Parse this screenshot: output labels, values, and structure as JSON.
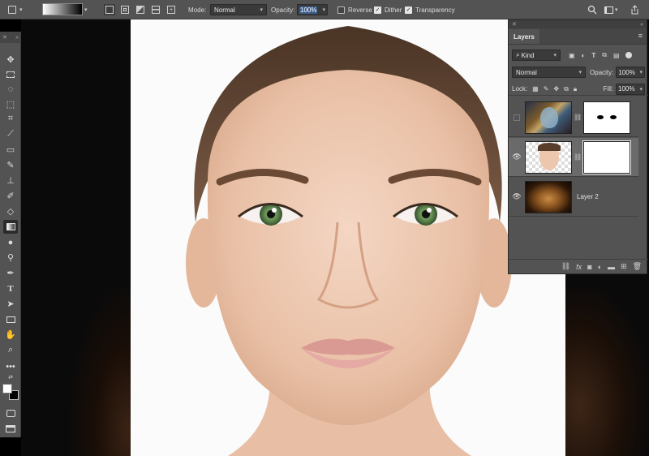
{
  "options_bar": {
    "mode_label": "Mode:",
    "mode_value": "Normal",
    "opacity_label": "Opacity:",
    "opacity_value": "100%",
    "reverse_label": "Reverse",
    "reverse_checked": false,
    "dither_label": "Dither",
    "dither_checked": true,
    "transparency_label": "Transparency",
    "transparency_checked": true
  },
  "toolbar": {
    "tools": [
      "move-tool",
      "marquee-tool",
      "lasso-tool",
      "quick-select-tool",
      "crop-tool",
      "eyedropper-tool",
      "healing-tool",
      "brush-tool",
      "clone-stamp-tool",
      "history-brush-tool",
      "eraser-tool",
      "gradient-tool",
      "blur-tool",
      "dodge-tool",
      "pen-tool",
      "type-tool",
      "path-select-tool",
      "rectangle-tool",
      "hand-tool",
      "zoom-tool",
      "more-tools",
      "swap-colors",
      "foreground-background",
      "quick-mask",
      "screen-mode"
    ],
    "active_tool": "gradient-tool"
  },
  "layers_panel": {
    "tab_label": "Layers",
    "filter_label": "Kind",
    "blend_mode": "Normal",
    "opacity_label": "Opacity:",
    "opacity_value": "100%",
    "lock_label": "Lock:",
    "fill_label": "Fill:",
    "fill_value": "100%",
    "layers": [
      {
        "name": "",
        "visible": false,
        "thumbnail": "venetian-mask-photo",
        "mask": "eye-shapes-mask"
      },
      {
        "name": "",
        "visible": true,
        "selected": true,
        "thumbnail": "woman-face-photo",
        "mask": "white-mask"
      },
      {
        "name": "Layer 2",
        "visible": true,
        "thumbnail": "lion-photo"
      }
    ]
  },
  "colors": {
    "ui_bg": "#535353",
    "canvas_bg": "#0a0a0a",
    "selection": "#3b5e8c",
    "eye_green": "#5e8a55"
  }
}
